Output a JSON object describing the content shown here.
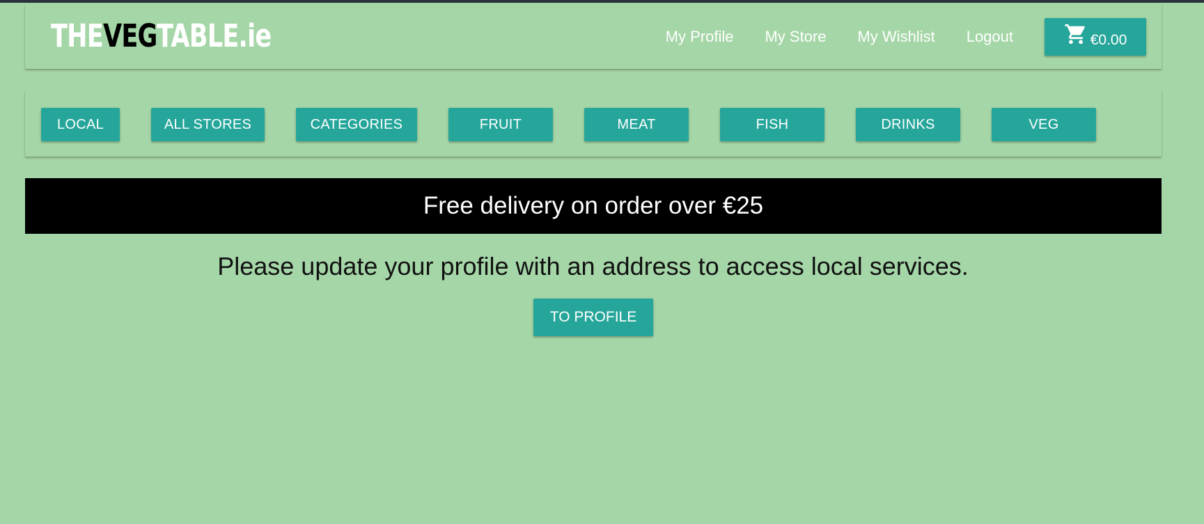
{
  "brand": {
    "part1": "THE",
    "part2": "VEG",
    "part3": "TABLE.ie"
  },
  "nav": {
    "links": [
      {
        "label": "My Profile"
      },
      {
        "label": "My Store"
      },
      {
        "label": "My Wishlist"
      },
      {
        "label": "Logout"
      }
    ],
    "cart": {
      "icon": "shopping-cart-icon",
      "amount": "€0.00"
    }
  },
  "categories": [
    {
      "label": "LOCAL"
    },
    {
      "label": "ALL STORES"
    },
    {
      "label": "CATEGORIES"
    },
    {
      "label": "FRUIT"
    },
    {
      "label": "MEAT"
    },
    {
      "label": "FISH"
    },
    {
      "label": "DRINKS"
    },
    {
      "label": "VEG"
    }
  ],
  "banner": {
    "text": "Free delivery on order over €25"
  },
  "notice": {
    "text": "Please update your profile with an address to access local services."
  },
  "profile_button": {
    "label": "TO PROFILE"
  },
  "colors": {
    "background": "#a5d6a7",
    "button": "#26a69a",
    "banner": "#000000",
    "text_light": "#ffffff"
  }
}
